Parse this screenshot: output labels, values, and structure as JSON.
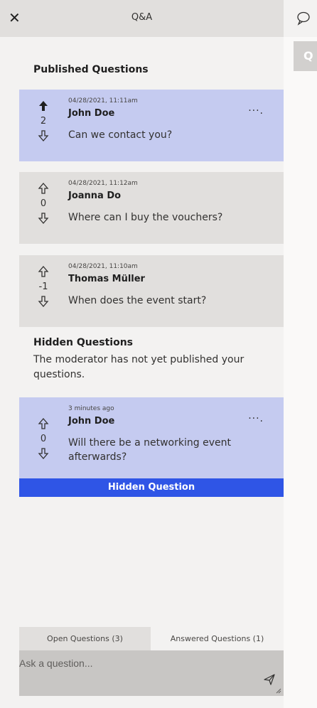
{
  "header": {
    "title": "Q&A",
    "close_icon": "close-icon"
  },
  "right_strip": {
    "icon": "chat-question-icon",
    "tab_label": "Q"
  },
  "published": {
    "heading": "Published Questions",
    "items": [
      {
        "time": "04/28/2021, 11:11am",
        "author": "John Doe",
        "question": "Can we contact you?",
        "votes": "2",
        "own": true,
        "upvoted": true,
        "more": "···."
      },
      {
        "time": "04/28/2021, 11:12am",
        "author": "Joanna Do",
        "question": "Where can I buy the vouchers?",
        "votes": "0",
        "own": false,
        "upvoted": false
      },
      {
        "time": "04/28/2021, 11:10am",
        "author": "Thomas Müller",
        "question": "When does the event start?",
        "votes": "-1",
        "own": false,
        "upvoted": false
      }
    ]
  },
  "hidden": {
    "heading": "Hidden Questions",
    "description": "The moderator has not yet published your questions.",
    "item": {
      "time": "3 minutes ago",
      "author": "John Doe",
      "question": "Will there be a networking event afterwards?",
      "votes": "0",
      "more": "···."
    },
    "banner": "Hidden Question"
  },
  "tabs": {
    "open": "Open Questions (3)",
    "answered": "Answered Questions (1)"
  },
  "ask": {
    "placeholder": "Ask a question...",
    "send_icon": "send-icon"
  },
  "colors": {
    "own_card": "#c5cbf0",
    "other_card": "#e1dfdd",
    "hidden_banner": "#2f55e6",
    "panel_bg": "#f3f2f1"
  }
}
